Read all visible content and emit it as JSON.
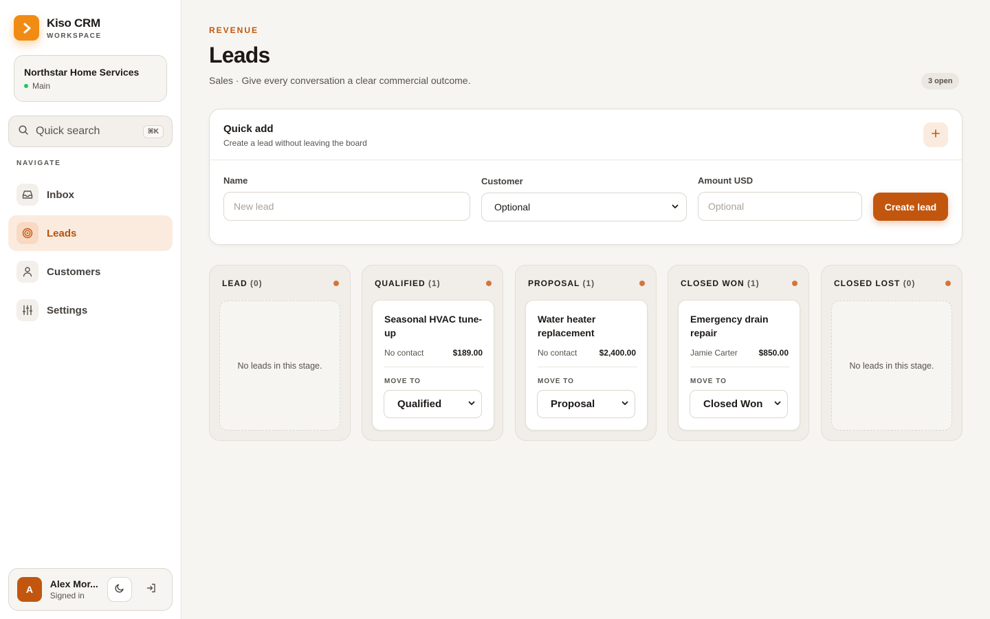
{
  "brand": {
    "name": "Kiso CRM",
    "subtitle": "WORKSPACE"
  },
  "org": {
    "name": "Northstar Home Services",
    "branch": "Main"
  },
  "search": {
    "placeholder": "Quick search",
    "shortcut": "⌘K"
  },
  "nav": {
    "label": "NAVIGATE",
    "items": [
      {
        "label": "Inbox",
        "icon": "inbox-icon",
        "active": false
      },
      {
        "label": "Leads",
        "icon": "target-icon",
        "active": true
      },
      {
        "label": "Customers",
        "icon": "user-icon",
        "active": false
      },
      {
        "label": "Settings",
        "icon": "sliders-icon",
        "active": false
      }
    ]
  },
  "user": {
    "initial": "A",
    "name": "Alex Mor...",
    "status": "Signed in"
  },
  "page": {
    "eyebrow": "REVENUE",
    "title": "Leads",
    "subtitle": "Sales · Give every conversation a clear commercial outcome.",
    "open_badge": "3 open"
  },
  "quick_add": {
    "title": "Quick add",
    "subtitle": "Create a lead without leaving the board",
    "add_icon": "plus-icon",
    "name_label": "Name",
    "name_placeholder": "New lead",
    "customer_label": "Customer",
    "customer_value": "Optional",
    "amount_label": "Amount USD",
    "amount_placeholder": "Optional",
    "create_label": "Create lead"
  },
  "board": {
    "empty_text": "No leads in this stage.",
    "move_to_label": "MOVE TO",
    "columns": [
      {
        "title": "LEAD",
        "count": "(0)",
        "cards": []
      },
      {
        "title": "QUALIFIED",
        "count": "(1)",
        "cards": [
          {
            "title": "Seasonal HVAC tune-up",
            "contact": "No contact",
            "amount": "$189.00",
            "stage": "Qualified"
          }
        ]
      },
      {
        "title": "PROPOSAL",
        "count": "(1)",
        "cards": [
          {
            "title": "Water heater replacement",
            "contact": "No contact",
            "amount": "$2,400.00",
            "stage": "Proposal"
          }
        ]
      },
      {
        "title": "CLOSED WON",
        "count": "(1)",
        "cards": [
          {
            "title": "Emergency drain repair",
            "contact": "Jamie Carter",
            "amount": "$850.00",
            "stage": "Closed Won"
          }
        ]
      },
      {
        "title": "CLOSED LOST",
        "count": "(0)",
        "cards": []
      }
    ]
  },
  "colors": {
    "accent": "#c2560f",
    "brand": "#f08c14",
    "stage_dot": "#d4763a",
    "online": "#22c55e"
  }
}
